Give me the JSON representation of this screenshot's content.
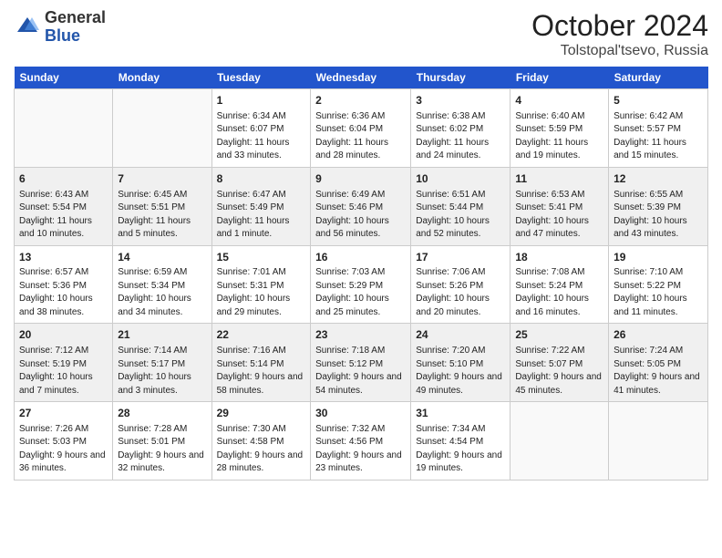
{
  "logo": {
    "line1": "General",
    "line2": "Blue"
  },
  "title": {
    "month_year": "October 2024",
    "location": "Tolstopal'tsevo, Russia"
  },
  "headers": [
    "Sunday",
    "Monday",
    "Tuesday",
    "Wednesday",
    "Thursday",
    "Friday",
    "Saturday"
  ],
  "weeks": [
    [
      {
        "day": "",
        "sunrise": "",
        "sunset": "",
        "daylight": ""
      },
      {
        "day": "",
        "sunrise": "",
        "sunset": "",
        "daylight": ""
      },
      {
        "day": "1",
        "sunrise": "Sunrise: 6:34 AM",
        "sunset": "Sunset: 6:07 PM",
        "daylight": "Daylight: 11 hours and 33 minutes."
      },
      {
        "day": "2",
        "sunrise": "Sunrise: 6:36 AM",
        "sunset": "Sunset: 6:04 PM",
        "daylight": "Daylight: 11 hours and 28 minutes."
      },
      {
        "day": "3",
        "sunrise": "Sunrise: 6:38 AM",
        "sunset": "Sunset: 6:02 PM",
        "daylight": "Daylight: 11 hours and 24 minutes."
      },
      {
        "day": "4",
        "sunrise": "Sunrise: 6:40 AM",
        "sunset": "Sunset: 5:59 PM",
        "daylight": "Daylight: 11 hours and 19 minutes."
      },
      {
        "day": "5",
        "sunrise": "Sunrise: 6:42 AM",
        "sunset": "Sunset: 5:57 PM",
        "daylight": "Daylight: 11 hours and 15 minutes."
      }
    ],
    [
      {
        "day": "6",
        "sunrise": "Sunrise: 6:43 AM",
        "sunset": "Sunset: 5:54 PM",
        "daylight": "Daylight: 11 hours and 10 minutes."
      },
      {
        "day": "7",
        "sunrise": "Sunrise: 6:45 AM",
        "sunset": "Sunset: 5:51 PM",
        "daylight": "Daylight: 11 hours and 5 minutes."
      },
      {
        "day": "8",
        "sunrise": "Sunrise: 6:47 AM",
        "sunset": "Sunset: 5:49 PM",
        "daylight": "Daylight: 11 hours and 1 minute."
      },
      {
        "day": "9",
        "sunrise": "Sunrise: 6:49 AM",
        "sunset": "Sunset: 5:46 PM",
        "daylight": "Daylight: 10 hours and 56 minutes."
      },
      {
        "day": "10",
        "sunrise": "Sunrise: 6:51 AM",
        "sunset": "Sunset: 5:44 PM",
        "daylight": "Daylight: 10 hours and 52 minutes."
      },
      {
        "day": "11",
        "sunrise": "Sunrise: 6:53 AM",
        "sunset": "Sunset: 5:41 PM",
        "daylight": "Daylight: 10 hours and 47 minutes."
      },
      {
        "day": "12",
        "sunrise": "Sunrise: 6:55 AM",
        "sunset": "Sunset: 5:39 PM",
        "daylight": "Daylight: 10 hours and 43 minutes."
      }
    ],
    [
      {
        "day": "13",
        "sunrise": "Sunrise: 6:57 AM",
        "sunset": "Sunset: 5:36 PM",
        "daylight": "Daylight: 10 hours and 38 minutes."
      },
      {
        "day": "14",
        "sunrise": "Sunrise: 6:59 AM",
        "sunset": "Sunset: 5:34 PM",
        "daylight": "Daylight: 10 hours and 34 minutes."
      },
      {
        "day": "15",
        "sunrise": "Sunrise: 7:01 AM",
        "sunset": "Sunset: 5:31 PM",
        "daylight": "Daylight: 10 hours and 29 minutes."
      },
      {
        "day": "16",
        "sunrise": "Sunrise: 7:03 AM",
        "sunset": "Sunset: 5:29 PM",
        "daylight": "Daylight: 10 hours and 25 minutes."
      },
      {
        "day": "17",
        "sunrise": "Sunrise: 7:06 AM",
        "sunset": "Sunset: 5:26 PM",
        "daylight": "Daylight: 10 hours and 20 minutes."
      },
      {
        "day": "18",
        "sunrise": "Sunrise: 7:08 AM",
        "sunset": "Sunset: 5:24 PM",
        "daylight": "Daylight: 10 hours and 16 minutes."
      },
      {
        "day": "19",
        "sunrise": "Sunrise: 7:10 AM",
        "sunset": "Sunset: 5:22 PM",
        "daylight": "Daylight: 10 hours and 11 minutes."
      }
    ],
    [
      {
        "day": "20",
        "sunrise": "Sunrise: 7:12 AM",
        "sunset": "Sunset: 5:19 PM",
        "daylight": "Daylight: 10 hours and 7 minutes."
      },
      {
        "day": "21",
        "sunrise": "Sunrise: 7:14 AM",
        "sunset": "Sunset: 5:17 PM",
        "daylight": "Daylight: 10 hours and 3 minutes."
      },
      {
        "day": "22",
        "sunrise": "Sunrise: 7:16 AM",
        "sunset": "Sunset: 5:14 PM",
        "daylight": "Daylight: 9 hours and 58 minutes."
      },
      {
        "day": "23",
        "sunrise": "Sunrise: 7:18 AM",
        "sunset": "Sunset: 5:12 PM",
        "daylight": "Daylight: 9 hours and 54 minutes."
      },
      {
        "day": "24",
        "sunrise": "Sunrise: 7:20 AM",
        "sunset": "Sunset: 5:10 PM",
        "daylight": "Daylight: 9 hours and 49 minutes."
      },
      {
        "day": "25",
        "sunrise": "Sunrise: 7:22 AM",
        "sunset": "Sunset: 5:07 PM",
        "daylight": "Daylight: 9 hours and 45 minutes."
      },
      {
        "day": "26",
        "sunrise": "Sunrise: 7:24 AM",
        "sunset": "Sunset: 5:05 PM",
        "daylight": "Daylight: 9 hours and 41 minutes."
      }
    ],
    [
      {
        "day": "27",
        "sunrise": "Sunrise: 7:26 AM",
        "sunset": "Sunset: 5:03 PM",
        "daylight": "Daylight: 9 hours and 36 minutes."
      },
      {
        "day": "28",
        "sunrise": "Sunrise: 7:28 AM",
        "sunset": "Sunset: 5:01 PM",
        "daylight": "Daylight: 9 hours and 32 minutes."
      },
      {
        "day": "29",
        "sunrise": "Sunrise: 7:30 AM",
        "sunset": "Sunset: 4:58 PM",
        "daylight": "Daylight: 9 hours and 28 minutes."
      },
      {
        "day": "30",
        "sunrise": "Sunrise: 7:32 AM",
        "sunset": "Sunset: 4:56 PM",
        "daylight": "Daylight: 9 hours and 23 minutes."
      },
      {
        "day": "31",
        "sunrise": "Sunrise: 7:34 AM",
        "sunset": "Sunset: 4:54 PM",
        "daylight": "Daylight: 9 hours and 19 minutes."
      },
      {
        "day": "",
        "sunrise": "",
        "sunset": "",
        "daylight": ""
      },
      {
        "day": "",
        "sunrise": "",
        "sunset": "",
        "daylight": ""
      }
    ]
  ],
  "row_shading": [
    false,
    true,
    false,
    true,
    false
  ]
}
